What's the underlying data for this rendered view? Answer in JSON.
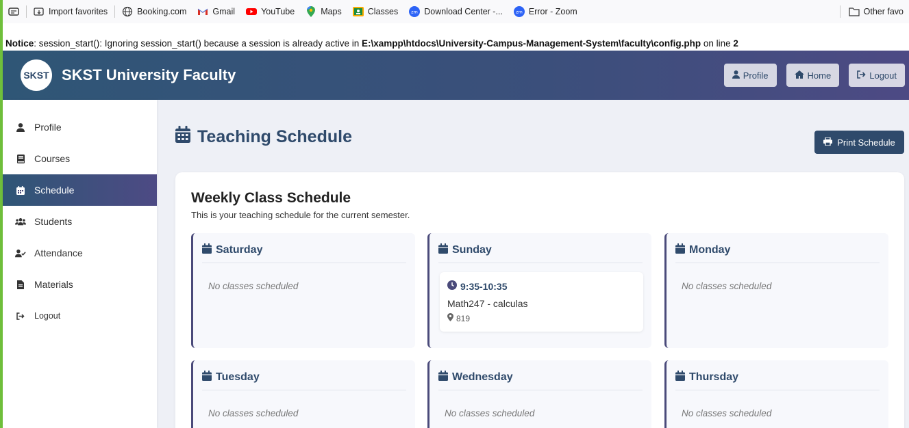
{
  "bookmarks": {
    "items": [
      {
        "label": "Import favorites",
        "icon": "import-icon"
      },
      {
        "label": "Booking.com",
        "icon": "globe-icon"
      },
      {
        "label": "Gmail",
        "icon": "gmail-icon"
      },
      {
        "label": "YouTube",
        "icon": "youtube-icon"
      },
      {
        "label": "Maps",
        "icon": "maps-icon"
      },
      {
        "label": "Classes",
        "icon": "classes-icon"
      },
      {
        "label": "Download Center -...",
        "icon": "zoom-icon"
      },
      {
        "label": "Error - Zoom",
        "icon": "zoom-icon"
      }
    ],
    "other": "Other favo"
  },
  "notice": {
    "label": "Notice",
    "text": ": session_start(): Ignoring session_start() because a session is already active in ",
    "path": "E:\\xampp\\htdocs\\University-Campus-Management-System\\faculty\\config.php",
    "on_line": " on line ",
    "line": "2"
  },
  "header": {
    "logo": "SKST",
    "brand": "SKST University Faculty",
    "buttons": {
      "profile": "Profile",
      "home": "Home",
      "logout": "Logout"
    }
  },
  "sidebar": {
    "items": [
      {
        "label": "Profile",
        "icon": "user-icon"
      },
      {
        "label": "Courses",
        "icon": "book-icon"
      },
      {
        "label": "Schedule",
        "icon": "calendar-icon"
      },
      {
        "label": "Students",
        "icon": "users-icon"
      },
      {
        "label": "Attendance",
        "icon": "user-check-icon"
      },
      {
        "label": "Materials",
        "icon": "file-icon"
      },
      {
        "label": "Logout",
        "icon": "logout-icon"
      }
    ]
  },
  "main": {
    "title": "Teaching Schedule",
    "print_label": "Print Schedule",
    "card_title": "Weekly Class Schedule",
    "card_subtitle": "This is your teaching schedule for the current semester.",
    "no_classes": "No classes scheduled",
    "days": {
      "saturday": "Saturday",
      "sunday": "Sunday",
      "monday": "Monday",
      "tuesday": "Tuesday",
      "wednesday": "Wednesday",
      "thursday": "Thursday"
    },
    "sunday_class": {
      "time": "9:35-10:35",
      "course": "Math247 - calculas",
      "room": "819"
    }
  },
  "colors": {
    "primary": "#2f4a6b",
    "accent": "#4d4a84",
    "browser_edge": "#6fbf3b"
  }
}
